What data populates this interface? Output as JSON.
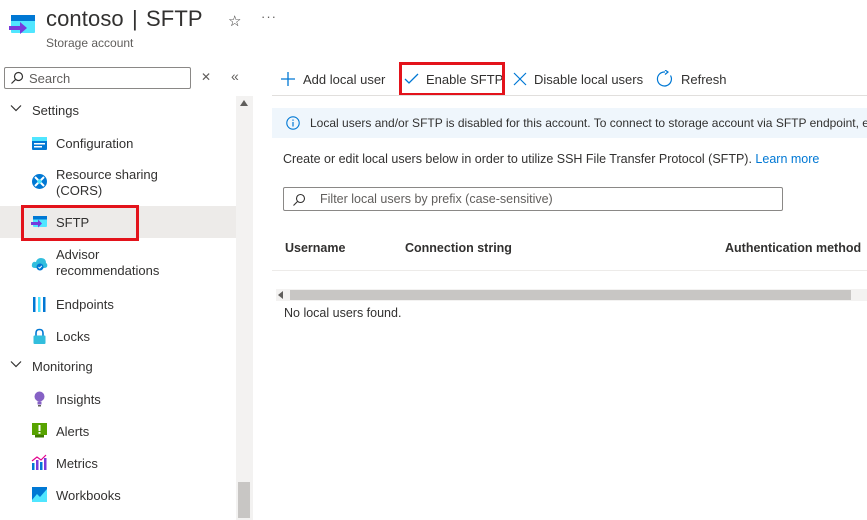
{
  "header": {
    "resource_name": "contoso",
    "separator": "|",
    "blade_name": "SFTP",
    "subtitle": "Storage account",
    "favorite_icon": "star-icon",
    "more_icon": "ellipsis-icon"
  },
  "sidebar": {
    "search_placeholder": "Search",
    "groups": [
      {
        "label": "Settings",
        "items": [
          {
            "label": "Configuration",
            "icon": "configuration-icon"
          },
          {
            "label_line1": "Resource sharing",
            "label_line2": "(CORS)",
            "icon": "cors-icon"
          },
          {
            "label": "SFTP",
            "icon": "sftp-icon",
            "selected": true
          },
          {
            "label_line1": "Advisor",
            "label_line2": "recommendations",
            "icon": "advisor-icon"
          },
          {
            "label": "Endpoints",
            "icon": "endpoints-icon"
          },
          {
            "label": "Locks",
            "icon": "lock-icon"
          }
        ]
      },
      {
        "label": "Monitoring",
        "items": [
          {
            "label": "Insights",
            "icon": "insights-icon"
          },
          {
            "label": "Alerts",
            "icon": "alerts-icon"
          },
          {
            "label": "Metrics",
            "icon": "metrics-icon"
          },
          {
            "label": "Workbooks",
            "icon": "workbooks-icon"
          }
        ]
      }
    ]
  },
  "toolbar": {
    "add_local_user": "Add local user",
    "enable_sftp": "Enable SFTP",
    "disable_local_users": "Disable local users",
    "refresh": "Refresh"
  },
  "main": {
    "banner_text": "Local users and/or SFTP is disabled for this account. To connect to storage account via SFTP endpoint, ena",
    "description": "Create or edit local users below in order to utilize SSH File Transfer Protocol (SFTP).",
    "learn_more": "Learn more",
    "filter_placeholder": "Filter local users by prefix (case-sensitive)",
    "columns": [
      "Username",
      "Connection string",
      "Authentication method"
    ],
    "empty_message": "No local users found."
  },
  "colors": {
    "accent": "#0078d4",
    "highlight": "#e3131b",
    "banner_bg": "#eff6fc",
    "selected_bg": "#edebe9"
  }
}
